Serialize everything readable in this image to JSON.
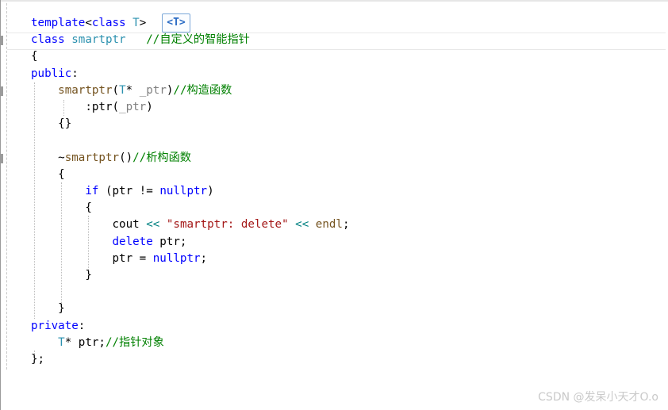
{
  "editor": {
    "hint_badge": "<T>",
    "lines": [
      {
        "tokens": [
          {
            "t": "template",
            "c": "kw"
          },
          {
            "t": "<",
            "c": "plain"
          },
          {
            "t": "class",
            "c": "kw"
          },
          {
            "t": " ",
            "c": "plain"
          },
          {
            "t": "T",
            "c": "tp"
          },
          {
            "t": ">",
            "c": "plain"
          }
        ]
      },
      {
        "tokens": [
          {
            "t": "class",
            "c": "kw"
          },
          {
            "t": " ",
            "c": "plain"
          },
          {
            "t": "smartptr",
            "c": "type"
          },
          {
            "t": "   ",
            "c": "plain"
          },
          {
            "t": "//自定义的智能指针",
            "c": "cm"
          }
        ]
      },
      {
        "tokens": [
          {
            "t": "{",
            "c": "plain"
          }
        ]
      },
      {
        "tokens": [
          {
            "t": "public",
            "c": "kw"
          },
          {
            "t": ":",
            "c": "plain"
          }
        ]
      },
      {
        "tokens": [
          {
            "t": "    ",
            "c": "plain"
          },
          {
            "t": "smartptr",
            "c": "fn"
          },
          {
            "t": "(",
            "c": "plain"
          },
          {
            "t": "T",
            "c": "tp"
          },
          {
            "t": "* ",
            "c": "plain"
          },
          {
            "t": "_ptr",
            "c": "par"
          },
          {
            "t": ")",
            "c": "plain"
          },
          {
            "t": "//构造函数",
            "c": "cm"
          }
        ]
      },
      {
        "tokens": [
          {
            "t": "        ",
            "c": "plain"
          },
          {
            "t": ":ptr(",
            "c": "plain"
          },
          {
            "t": "_ptr",
            "c": "par"
          },
          {
            "t": ")",
            "c": "plain"
          }
        ]
      },
      {
        "tokens": [
          {
            "t": "    ",
            "c": "plain"
          },
          {
            "t": "{}",
            "c": "plain"
          }
        ]
      },
      {
        "tokens": []
      },
      {
        "tokens": [
          {
            "t": "    ",
            "c": "plain"
          },
          {
            "t": "~",
            "c": "plain"
          },
          {
            "t": "smartptr",
            "c": "fn"
          },
          {
            "t": "()",
            "c": "plain"
          },
          {
            "t": "//析构函数",
            "c": "cm"
          }
        ]
      },
      {
        "tokens": [
          {
            "t": "    ",
            "c": "plain"
          },
          {
            "t": "{",
            "c": "plain"
          }
        ]
      },
      {
        "tokens": [
          {
            "t": "        ",
            "c": "plain"
          },
          {
            "t": "if",
            "c": "kw"
          },
          {
            "t": " (ptr != ",
            "c": "plain"
          },
          {
            "t": "nullptr",
            "c": "kw"
          },
          {
            "t": ")",
            "c": "plain"
          }
        ]
      },
      {
        "tokens": [
          {
            "t": "        ",
            "c": "plain"
          },
          {
            "t": "{",
            "c": "plain"
          }
        ]
      },
      {
        "tokens": [
          {
            "t": "            ",
            "c": "plain"
          },
          {
            "t": "cout ",
            "c": "plain"
          },
          {
            "t": "<<",
            "c": "op"
          },
          {
            "t": " ",
            "c": "plain"
          },
          {
            "t": "\"smartptr: delete\"",
            "c": "str"
          },
          {
            "t": " ",
            "c": "plain"
          },
          {
            "t": "<<",
            "c": "op"
          },
          {
            "t": " ",
            "c": "plain"
          },
          {
            "t": "endl",
            "c": "fn"
          },
          {
            "t": ";",
            "c": "plain"
          }
        ]
      },
      {
        "tokens": [
          {
            "t": "            ",
            "c": "plain"
          },
          {
            "t": "delete",
            "c": "kw"
          },
          {
            "t": " ptr;",
            "c": "plain"
          }
        ]
      },
      {
        "tokens": [
          {
            "t": "            ",
            "c": "plain"
          },
          {
            "t": "ptr = ",
            "c": "plain"
          },
          {
            "t": "nullptr",
            "c": "kw"
          },
          {
            "t": ";",
            "c": "plain"
          }
        ]
      },
      {
        "tokens": [
          {
            "t": "        ",
            "c": "plain"
          },
          {
            "t": "}",
            "c": "plain"
          }
        ]
      },
      {
        "tokens": []
      },
      {
        "tokens": [
          {
            "t": "    ",
            "c": "plain"
          },
          {
            "t": "}",
            "c": "plain"
          }
        ]
      },
      {
        "tokens": [
          {
            "t": "private",
            "c": "kw"
          },
          {
            "t": ":",
            "c": "plain"
          }
        ]
      },
      {
        "tokens": [
          {
            "t": "    ",
            "c": "plain"
          },
          {
            "t": "T",
            "c": "tp"
          },
          {
            "t": "* ptr;",
            "c": "plain"
          },
          {
            "t": "//指针对象",
            "c": "cm"
          }
        ]
      },
      {
        "tokens": [
          {
            "t": "};",
            "c": "plain"
          }
        ]
      }
    ]
  },
  "watermark": "CSDN @发呆小天才O.o",
  "colors": {
    "keyword": "#0000ff",
    "type": "#2b91af",
    "function": "#74531f",
    "parameter": "#808080",
    "comment": "#008000",
    "string": "#a31515",
    "operator": "#008080"
  }
}
